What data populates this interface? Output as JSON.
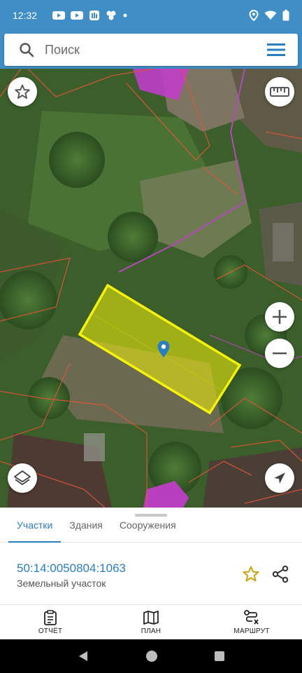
{
  "status_bar": {
    "time": "12:32",
    "left_icons": [
      "youtube-icon",
      "youtube-icon",
      "news-icon",
      "app-icon",
      "dot-icon"
    ],
    "right_icons": [
      "location-icon",
      "wifi-icon",
      "battery-icon"
    ]
  },
  "search": {
    "placeholder": "Поиск"
  },
  "map": {
    "buttons": [
      "star-icon",
      "ruler-icon",
      "zoom-in-icon",
      "zoom-out-icon",
      "layers-icon",
      "locate-icon"
    ],
    "colors": {
      "parcel": "#f4f20a",
      "boundary": "#e2553a",
      "buildings": "#d040d0",
      "pin": "#2a7ec0"
    }
  },
  "tabs": [
    {
      "label": "Участки",
      "active": true
    },
    {
      "label": "Здания",
      "active": false
    },
    {
      "label": "Сооружения",
      "active": false
    }
  ],
  "parcel": {
    "cadastral_number": "50:14:0050804:1063",
    "type": "Земельный участок"
  },
  "bottom_nav": [
    {
      "label": "ОТЧЁТ",
      "icon": "clipboard-icon"
    },
    {
      "label": "ПЛАН",
      "icon": "map-icon"
    },
    {
      "label": "МАРШРУТ",
      "icon": "route-icon"
    }
  ],
  "accent_color": "#2a7ec0",
  "header_color": "#3f8ec6"
}
